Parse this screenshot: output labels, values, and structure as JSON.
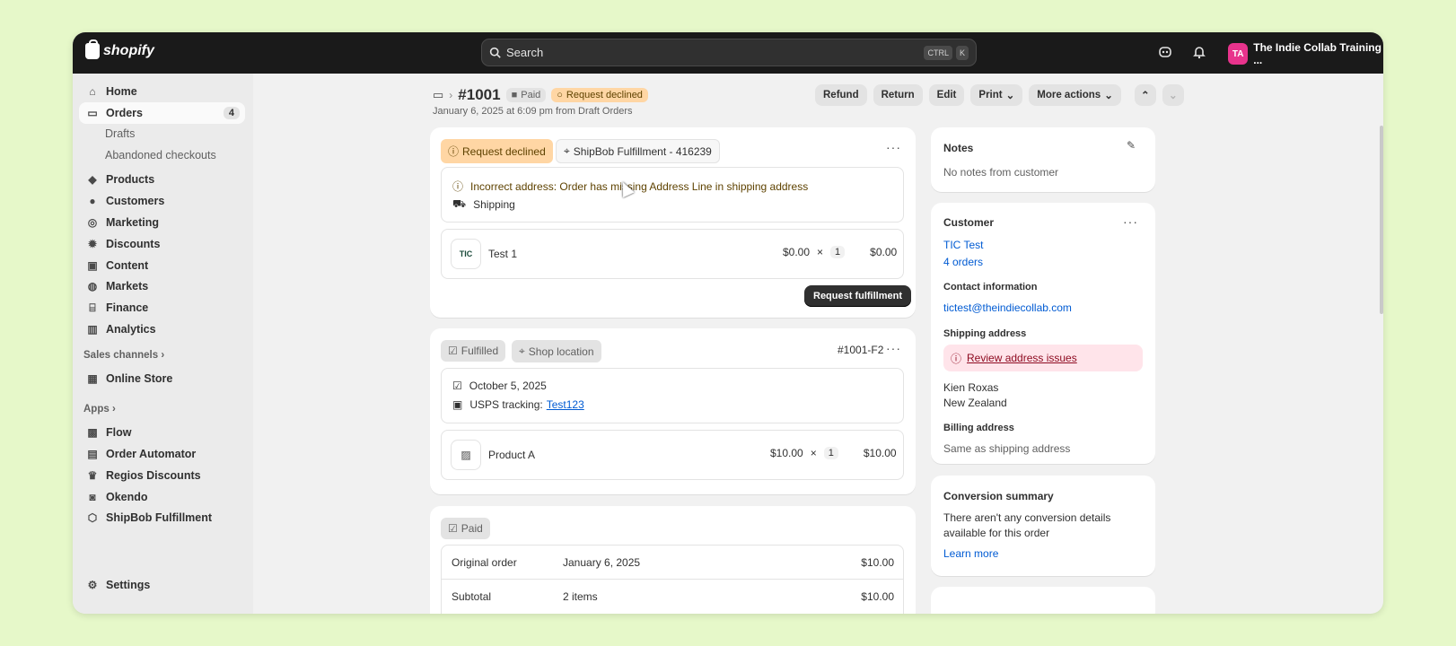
{
  "topbar": {
    "brand": "shopify",
    "search_placeholder": "Search",
    "shortcut_keys": [
      "CTRL",
      "K"
    ],
    "store_initials": "TA",
    "store_name": "The Indie Collab Training ..."
  },
  "sidebar": {
    "home": "Home",
    "orders": "Orders",
    "orders_count": "4",
    "drafts": "Drafts",
    "abandoned": "Abandoned checkouts",
    "products": "Products",
    "customers": "Customers",
    "marketing": "Marketing",
    "discounts": "Discounts",
    "content": "Content",
    "markets": "Markets",
    "finance": "Finance",
    "analytics": "Analytics",
    "sales_channels": "Sales channels",
    "online_store": "Online Store",
    "apps": "Apps",
    "app_items": [
      "Flow",
      "Order Automator",
      "Regios Discounts",
      "Okendo",
      "ShipBob Fulfillment"
    ],
    "settings": "Settings"
  },
  "order": {
    "number": "#1001",
    "paid_badge": "Paid",
    "request_badge": "Request declined",
    "subtitle": "January 6, 2025 at 6:09 pm from Draft Orders",
    "actions": {
      "refund": "Refund",
      "return": "Return",
      "edit": "Edit",
      "print": "Print",
      "more": "More actions"
    }
  },
  "fulfillment_request": {
    "status": "Request declined",
    "location": "ShipBob Fulfillment - 416239",
    "error": "Incorrect address: Order has missing Address Line in shipping address",
    "method": "Shipping",
    "item_name": "Test 1",
    "item_price": "$0.00",
    "item_times": "×",
    "item_qty": "1",
    "item_total": "$0.00",
    "button": "Request fulfillment"
  },
  "fulfilled": {
    "status": "Fulfilled",
    "location": "Shop location",
    "id": "#1001-F2",
    "date": "October 5, 2025",
    "tracking_label": "USPS tracking:",
    "tracking_number": "Test123",
    "item_name": "Product A",
    "item_price": "$10.00",
    "item_times": "×",
    "item_qty": "1",
    "item_total": "$10.00"
  },
  "payment": {
    "status": "Paid",
    "rows": [
      {
        "label": "Original order",
        "detail": "January 6, 2025",
        "amount": "$10.00"
      },
      {
        "label": "Subtotal",
        "detail": "2 items",
        "amount": "$10.00"
      }
    ]
  },
  "notes": {
    "title": "Notes",
    "text": "No notes from customer"
  },
  "customer": {
    "title": "Customer",
    "name": "TIC Test",
    "orders": "4 orders",
    "contact_title": "Contact information",
    "email": "tictest@theindiecollab.com",
    "shipping_title": "Shipping address",
    "review": "Review address issues",
    "address_line1": "Kien Roxas",
    "address_line2": "New Zealand",
    "billing_title": "Billing address",
    "billing_text": "Same as shipping address"
  },
  "conversion": {
    "title": "Conversion summary",
    "text_line1": "There aren't any conversion details",
    "text_line2": "available for this order",
    "link": "Learn more"
  }
}
